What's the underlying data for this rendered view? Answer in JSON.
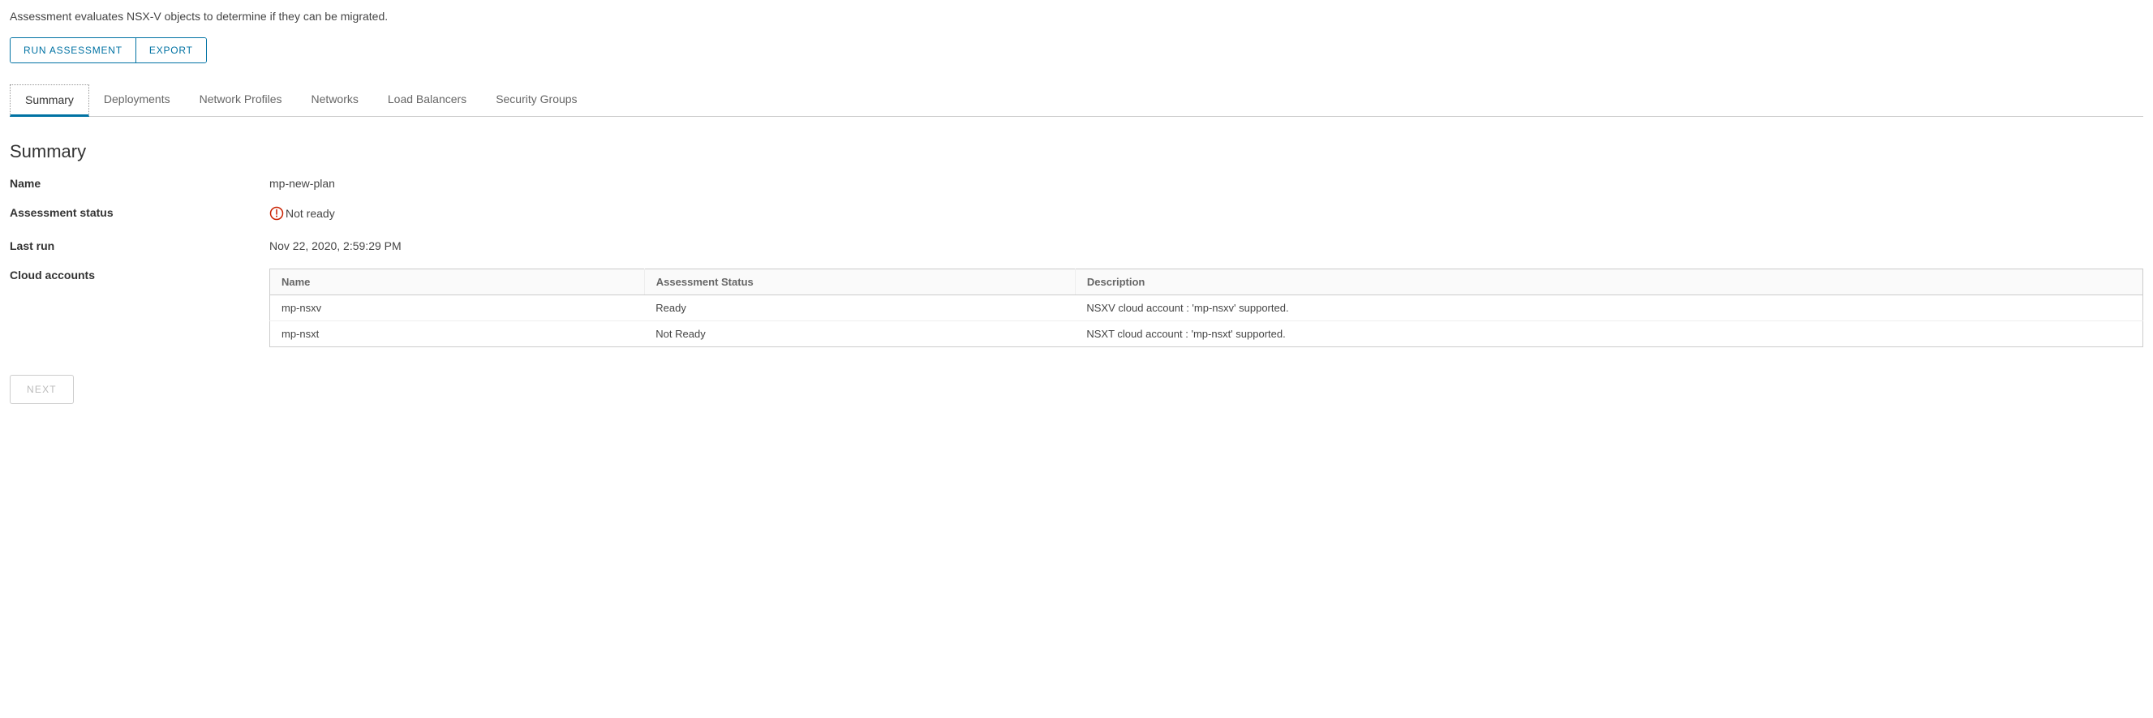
{
  "description": "Assessment evaluates NSX-V objects to determine if they can be migrated.",
  "actions": {
    "run_assessment": "RUN ASSESSMENT",
    "export": "EXPORT"
  },
  "tabs": [
    {
      "label": "Summary"
    },
    {
      "label": "Deployments"
    },
    {
      "label": "Network Profiles"
    },
    {
      "label": "Networks"
    },
    {
      "label": "Load Balancers"
    },
    {
      "label": "Security Groups"
    }
  ],
  "section_title": "Summary",
  "summary": {
    "name_label": "Name",
    "name_value": "mp-new-plan",
    "status_label": "Assessment status",
    "status_value": "Not ready",
    "lastrun_label": "Last run",
    "lastrun_value": "Nov 22, 2020, 2:59:29 PM",
    "cloud_label": "Cloud accounts"
  },
  "cloud_table": {
    "headers": {
      "name": "Name",
      "status": "Assessment Status",
      "description": "Description"
    },
    "rows": [
      {
        "name": "mp-nsxv",
        "status": "Ready",
        "description": "NSXV cloud account : 'mp-nsxv' supported."
      },
      {
        "name": "mp-nsxt",
        "status": "Not Ready",
        "description": "NSXT cloud account : 'mp-nsxt' supported."
      }
    ]
  },
  "next_label": "NEXT"
}
